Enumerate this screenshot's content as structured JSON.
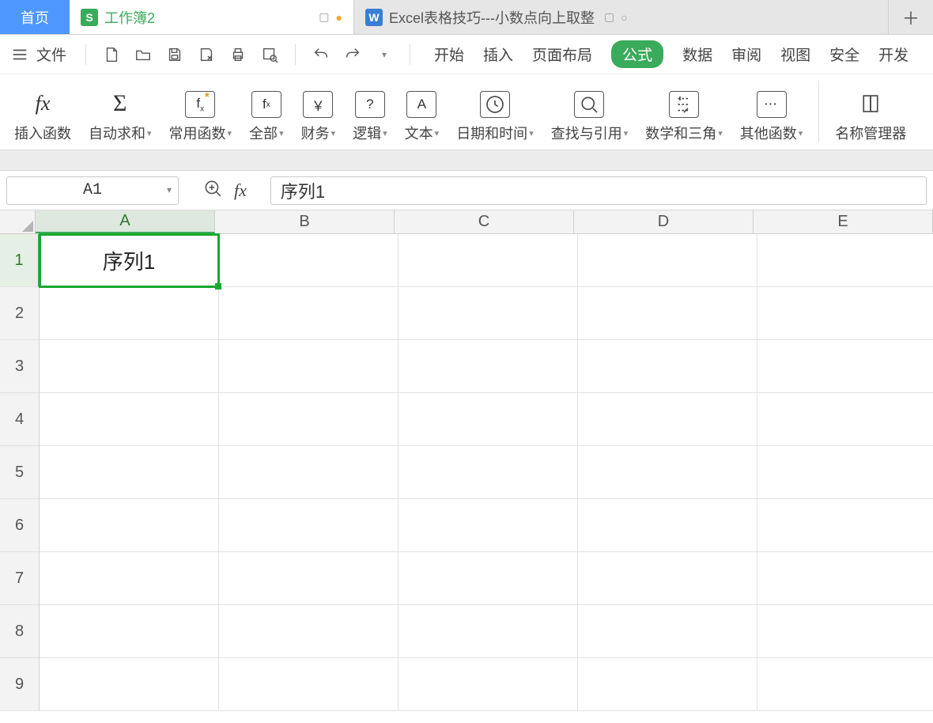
{
  "titlebar": {
    "home_label": "首页",
    "active_tab_label": "工作簿2",
    "other_tab_label": "Excel表格技巧---小数点向上取整",
    "s_icon_glyph": "S",
    "w_icon_glyph": "W",
    "present_glyph": "▢",
    "dirty_glyph": "●",
    "small_circle_glyph": "○",
    "add_glyph": "＋"
  },
  "menubar": {
    "file_label": "文件",
    "ribbon_tabs": [
      "开始",
      "插入",
      "页面布局",
      "公式",
      "数据",
      "审阅",
      "视图",
      "安全",
      "开发"
    ],
    "active_ribbon_index": 3,
    "dropdown_glyph": "▾"
  },
  "ribbon_groups": [
    {
      "icon_text": "fx",
      "label": "插入函数",
      "dropdown": false,
      "icon": "fx"
    },
    {
      "icon_text": "Σ",
      "label": "自动求和",
      "dropdown": true,
      "icon": "sigma"
    },
    {
      "icon_text": "fx",
      "label": "常用函数",
      "dropdown": true,
      "icon": "box-fx-star"
    },
    {
      "icon_text": "fx",
      "label": "全部",
      "dropdown": true,
      "icon": "box-fx"
    },
    {
      "icon_text": "￥",
      "label": "财务",
      "dropdown": true,
      "icon": "box-yen"
    },
    {
      "icon_text": "?",
      "label": "逻辑",
      "dropdown": true,
      "icon": "box-q"
    },
    {
      "icon_text": "A",
      "label": "文本",
      "dropdown": true,
      "icon": "box-a"
    },
    {
      "icon_text": "",
      "label": "日期和时间",
      "dropdown": true,
      "icon": "box-clock"
    },
    {
      "icon_text": "",
      "label": "查找与引用",
      "dropdown": true,
      "icon": "box-search"
    },
    {
      "icon_text": "",
      "label": "数学和三角",
      "dropdown": true,
      "icon": "box-math"
    },
    {
      "icon_text": "⋯",
      "label": "其他函数",
      "dropdown": true,
      "icon": "box-dots"
    },
    {
      "divider": true
    },
    {
      "icon_text": "",
      "label": "名称管理器",
      "dropdown": false,
      "icon": "book"
    }
  ],
  "formula_bar": {
    "name_box_value": "A1",
    "fx_label": "fx",
    "formula_value": "序列1"
  },
  "sheet": {
    "columns": [
      "A",
      "B",
      "C",
      "D",
      "E"
    ],
    "selected_col_index": 0,
    "rows": [
      1,
      2,
      3,
      4,
      5,
      6,
      7,
      8,
      9
    ],
    "selected_row_index": 0,
    "cells": {
      "A1": "序列1"
    },
    "selected_cell": "A1"
  },
  "colors": {
    "primary_blue": "#4d97ff",
    "brand_green": "#3aab5a",
    "selection_green": "#18a830"
  }
}
